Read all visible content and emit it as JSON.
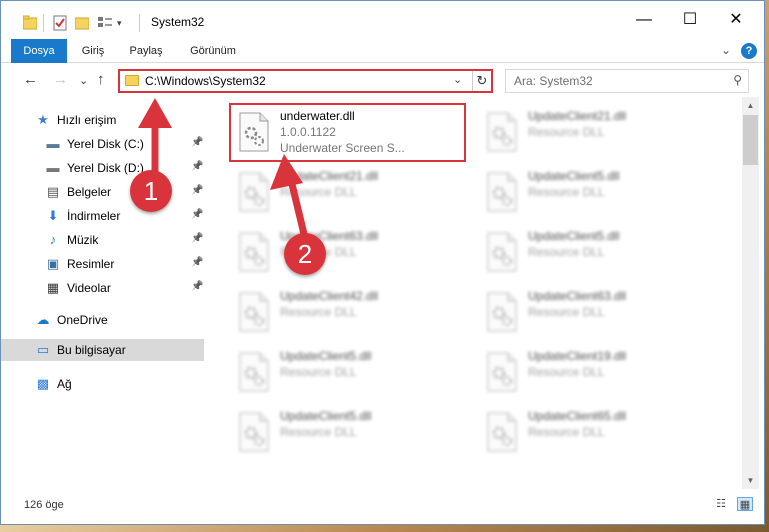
{
  "window": {
    "title": "System32",
    "minimize": "—",
    "maximize": "☐",
    "close": "✕"
  },
  "ribbon": {
    "tabs": [
      {
        "label": "Dosya",
        "active": true
      },
      {
        "label": "Giriş",
        "active": false
      },
      {
        "label": "Paylaş",
        "active": false
      },
      {
        "label": "Görünüm",
        "active": false
      }
    ],
    "expand": "⌄",
    "help": "?"
  },
  "nav": {
    "back": "←",
    "forward": "→",
    "recent": "⌄",
    "up": "↑",
    "address": "C:\\Windows\\System32",
    "address_dropdown": "⌄",
    "refresh": "↻",
    "search_placeholder": "Ara: System32",
    "search_icon": "⚲"
  },
  "sidebar": {
    "items": [
      {
        "label": "Hızlı erişim",
        "icon": "star-icon",
        "glyph": "★",
        "color": "#3a7fd5",
        "pinned": false,
        "indent": 1,
        "selected": false
      },
      {
        "label": "Yerel Disk (C:)",
        "icon": "drive-icon",
        "glyph": "▬",
        "color": "#5a7a9a",
        "pinned": true,
        "indent": 2,
        "selected": false
      },
      {
        "label": "Yerel Disk (D:)",
        "icon": "drive-icon",
        "glyph": "▬",
        "color": "#777777",
        "pinned": true,
        "indent": 2,
        "selected": false
      },
      {
        "label": "Belgeler",
        "icon": "documents-icon",
        "glyph": "▤",
        "color": "#555555",
        "pinned": true,
        "indent": 2,
        "selected": false
      },
      {
        "label": "İndirmeler",
        "icon": "download-icon",
        "glyph": "⬇",
        "color": "#2a7ad9",
        "pinned": true,
        "indent": 2,
        "selected": false
      },
      {
        "label": "Müzik",
        "icon": "music-icon",
        "glyph": "♪",
        "color": "#2a7ad9",
        "pinned": true,
        "indent": 2,
        "selected": false
      },
      {
        "label": "Resimler",
        "icon": "pictures-icon",
        "glyph": "▣",
        "color": "#3a6fa0",
        "pinned": true,
        "indent": 2,
        "selected": false
      },
      {
        "label": "Videolar",
        "icon": "video-icon",
        "glyph": "▦",
        "color": "#333333",
        "pinned": true,
        "indent": 2,
        "selected": false
      },
      {
        "label": "OneDrive",
        "icon": "cloud-icon",
        "glyph": "☁",
        "color": "#1979ca",
        "pinned": false,
        "indent": 1,
        "selected": false
      },
      {
        "label": "Bu bilgisayar",
        "icon": "computer-icon",
        "glyph": "▭",
        "color": "#2a7ad9",
        "pinned": false,
        "indent": 1,
        "selected": true
      },
      {
        "label": "Ağ",
        "icon": "network-icon",
        "glyph": "▩",
        "color": "#2a7ad9",
        "pinned": false,
        "indent": 1,
        "selected": false
      }
    ]
  },
  "files": [
    {
      "name": "underwater.dll",
      "line2": "1.0.0.1122",
      "line3": "Underwater Screen S...",
      "blurred": false,
      "col": 0,
      "row": 0
    },
    {
      "name": "UpdateClient21.dll",
      "line2": "Resource DLL",
      "line3": "",
      "blurred": true,
      "col": 1,
      "row": 0
    },
    {
      "name": "UpdateClient21.dll",
      "line2": "Resource DLL",
      "line3": "",
      "blurred": true,
      "col": 0,
      "row": 1
    },
    {
      "name": "UpdateClient5.dll",
      "line2": "Resource DLL",
      "line3": "",
      "blurred": true,
      "col": 1,
      "row": 1
    },
    {
      "name": "UpdateClient63.dll",
      "line2": "Resource DLL",
      "line3": "",
      "blurred": true,
      "col": 0,
      "row": 2
    },
    {
      "name": "UpdateClient5.dll",
      "line2": "Resource DLL",
      "line3": "",
      "blurred": true,
      "col": 1,
      "row": 2
    },
    {
      "name": "UpdateClient42.dll",
      "line2": "Resource DLL",
      "line3": "",
      "blurred": true,
      "col": 0,
      "row": 3
    },
    {
      "name": "UpdateClient63.dll",
      "line2": "Resource DLL",
      "line3": "",
      "blurred": true,
      "col": 1,
      "row": 3
    },
    {
      "name": "UpdateClient5.dll",
      "line2": "Resource DLL",
      "line3": "",
      "blurred": true,
      "col": 0,
      "row": 4
    },
    {
      "name": "UpdateClient19.dll",
      "line2": "Resource DLL",
      "line3": "",
      "blurred": true,
      "col": 1,
      "row": 4
    },
    {
      "name": "UpdateClient5.dll",
      "line2": "Resource DLL",
      "line3": "",
      "blurred": true,
      "col": 0,
      "row": 5
    },
    {
      "name": "UpdateClient65.dll",
      "line2": "Resource DLL",
      "line3": "",
      "blurred": true,
      "col": 1,
      "row": 5
    }
  ],
  "status": {
    "count": "126 öge",
    "details_view": "☷",
    "tiles_view": "▦"
  },
  "annotations": {
    "step1": "1",
    "step2": "2",
    "color": "#d9343c"
  }
}
